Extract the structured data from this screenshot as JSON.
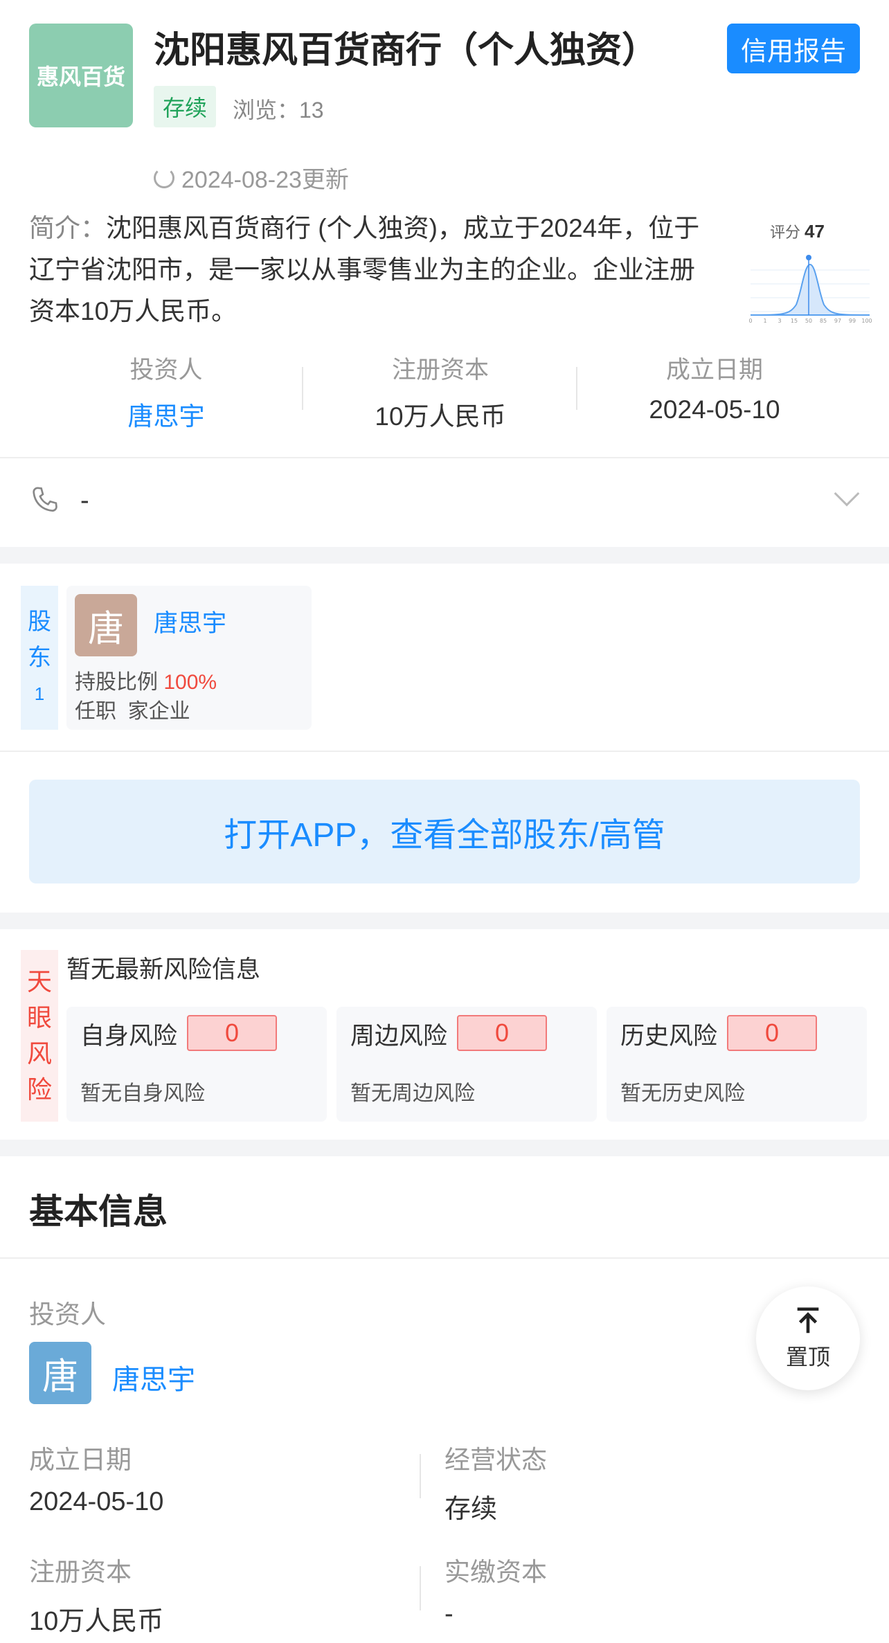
{
  "company": {
    "logo_text": "惠风百货",
    "name": "沈阳惠风百货商行（个人独资）",
    "status": "存续",
    "views": "浏览：13",
    "updated": "2024-08-23更新",
    "credit_report_label": "信用报告"
  },
  "intro": {
    "label": "简介：",
    "text": "沈阳惠风百货商行 (个人独资)，成立于2024年，位于辽宁省沈阳市，是一家以从事零售业为主的企业。企业注册资本10万人民币。"
  },
  "score": {
    "label": "评分",
    "value": "47",
    "axis_ticks": [
      "0",
      "1",
      "3",
      "15",
      "50",
      "85",
      "97",
      "99",
      "100"
    ]
  },
  "key_stats": [
    {
      "label": "投资人",
      "value": "唐思宇"
    },
    {
      "label": "注册资本",
      "value": "10万人民币"
    },
    {
      "label": "成立日期",
      "value": "2024-05-10"
    }
  ],
  "phone": {
    "value": "-"
  },
  "shareholders": {
    "tag": [
      "股",
      "东"
    ],
    "count": "1",
    "items": [
      {
        "avatar": "唐",
        "name": "唐思宇",
        "ratio_label": "持股比例",
        "ratio": "100%",
        "role_label": "任职",
        "role_value": "家企业"
      }
    ]
  },
  "open_app_label": "打开APP，查看全部股东/高管",
  "risk": {
    "tag": [
      "天",
      "眼",
      "风",
      "险"
    ],
    "headline": "暂无最新风险信息",
    "cards": [
      {
        "title": "自身风险",
        "count": "0",
        "subtitle": "暂无自身风险"
      },
      {
        "title": "周边风险",
        "count": "0",
        "subtitle": "暂无周边风险"
      },
      {
        "title": "历史风险",
        "count": "0",
        "subtitle": "暂无历史风险"
      }
    ]
  },
  "basic_info": {
    "title": "基本信息",
    "investor_label": "投资人",
    "investor_avatar": "唐",
    "investor_name": "唐思宇",
    "fields": [
      {
        "label": "成立日期",
        "value": "2024-05-10"
      },
      {
        "label": "经营状态",
        "value": "存续"
      },
      {
        "label": "注册资本",
        "value": "10万人民币"
      },
      {
        "label": "实缴资本",
        "value": "-"
      }
    ]
  },
  "back_to_top_label": "置顶",
  "colors": {
    "accent": "#1a8cff",
    "green": "#20a35a",
    "red": "#f04a3e",
    "logo_bg": "#8ccdb0"
  }
}
